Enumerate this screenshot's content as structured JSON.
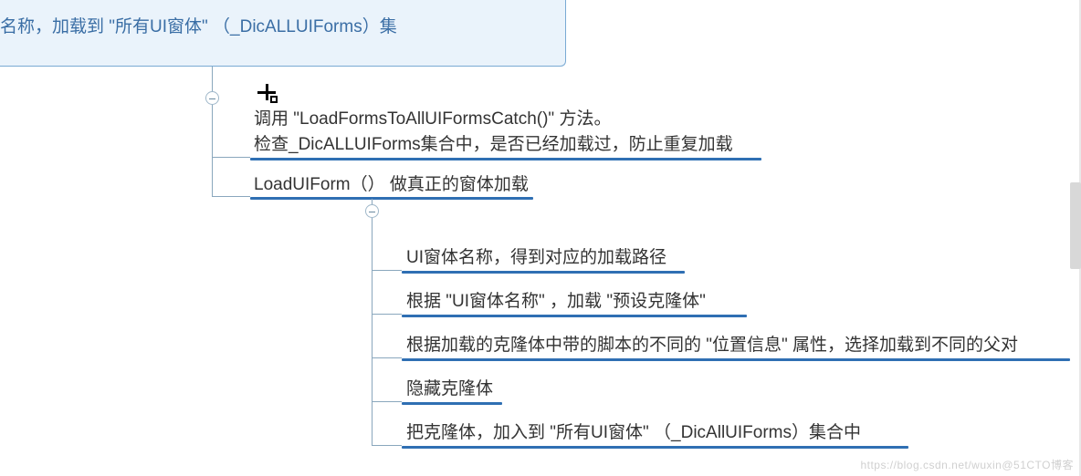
{
  "root": {
    "title": "名称，加载到 \"所有UI窗体\" （_DicALLUIForms）集"
  },
  "branch1": {
    "line1": "调用 \"LoadFormsToAllUIFormsCatch()\" 方法。",
    "line2": "检查_DicALLUIForms集合中，是否已经加载过，防止重复加载"
  },
  "branch2": {
    "title": "LoadUIForm（） 做真正的窗体加载",
    "children": [
      "UI窗体名称，得到对应的加载路径",
      "根据 \"UI窗体名称\" ，加载 \"预设克隆体\"",
      "根据加载的克隆体中带的脚本的不同的 \"位置信息\" 属性，选择加载到不同的父对",
      "隐藏克隆体",
      "把克隆体，加入到 \"所有UI窗体\" （_DicAllUIForms）集合中"
    ]
  },
  "watermark": "https://blog.csdn.net/wuxin@51CTO博客"
}
